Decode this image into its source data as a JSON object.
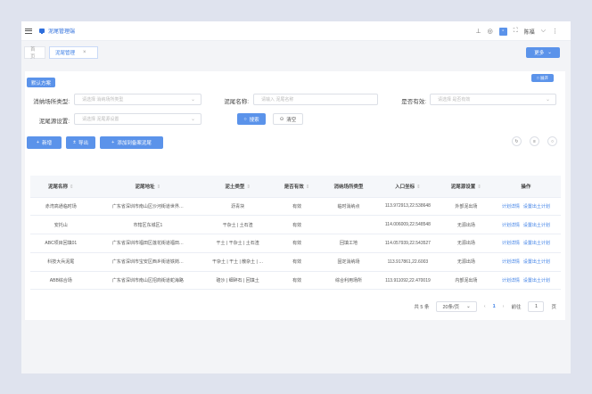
{
  "header": {
    "title": "泥尾管理端",
    "icons": [
      "menu-icon",
      "upload-icon",
      "eye-icon",
      "app-square-icon",
      "fullscreen-icon",
      "more-vertical-icon"
    ],
    "user_name": "陈福"
  },
  "tabs": [
    {
      "label": "首页",
      "active": false
    },
    {
      "label": "泥尾管理",
      "active": true,
      "close": "×"
    }
  ],
  "more_button": "更多",
  "toolbar": {
    "default_scheme": "默认方案",
    "right_button": "□ 展开"
  },
  "filters": {
    "site_type": {
      "label": "消纳场所类型:",
      "placeholder": "请选择 消纳场所类型"
    },
    "mud_name": {
      "label": "泥尾名称:",
      "placeholder": "请输入 泥尾名称"
    },
    "valid": {
      "label": "是否有效:",
      "placeholder": "请选择 是否有效"
    },
    "source": {
      "label": "泥尾源设置:",
      "placeholder": "请选择 泥尾源设置"
    },
    "search": "搜索",
    "reset": "清空"
  },
  "actions": {
    "add": "新增",
    "export": "导出",
    "add_to_standby": "添加到备案泥尾"
  },
  "table": {
    "headers": [
      "泥尾名称",
      "泥尾地址",
      "泥土类型",
      "是否有效",
      "消纳场所类型",
      "入口坐标",
      "泥尾源设置",
      "操作"
    ],
    "rows": [
      [
        "赤湾高通临时场",
        "广东省深圳市南山区沙河街道世界…",
        "沥青块",
        "有效",
        "临时消纳点",
        "113.972913,22.538648",
        "外部泥出场"
      ],
      [
        "安托山",
        "市辖区东城区1",
        "干杂土 | 土石渣",
        "有效",
        "",
        "114.006009,22.548548",
        "无源出场"
      ],
      [
        "ABC项目回填01",
        "广东省深圳市福田区莲花街道福田…",
        "干土 | 干杂土 | 土石渣",
        "有效",
        "回填工地",
        "114.057939,22.543527",
        "无源出场"
      ],
      [
        "科技大兵泥尾",
        "广东省深圳市宝安区西乡街道铁岗…",
        "干杂土 | 干土 | 散杂土 | …",
        "有效",
        "固定消纳场",
        "113.917861,22.6003",
        "无源出场"
      ],
      [
        "ABB综合场",
        "广东省深圳市南山区招商街道蛇海路",
        "碴沙 | 细碎石 | 回填土",
        "有效",
        "综合利用场所",
        "113.911092,22.470019",
        "内部泥出场"
      ]
    ],
    "op_detail": "计划详情",
    "op_setplan": "设置出土计划"
  },
  "pagination": {
    "total": "共 5 条",
    "page_size": "20条/页",
    "current": "1",
    "goto": "前往",
    "goto_value": "1",
    "page_unit": "页"
  }
}
